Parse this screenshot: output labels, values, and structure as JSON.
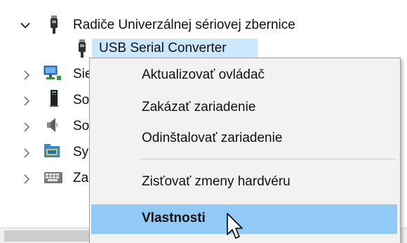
{
  "tree": {
    "usb_controllers": {
      "label": "Radiče Univerzálnej sériovej zbernice",
      "expanded": true,
      "icon": "usb-plug-icon"
    },
    "usb_serial": {
      "label": "USB Serial Converter",
      "selected": true,
      "icon": "usb-plug-icon"
    },
    "network": {
      "label": "Sie",
      "icon": "network-adapter-icon"
    },
    "software": {
      "label": "So",
      "icon": "tower-pc-icon"
    },
    "sound": {
      "label": "So",
      "icon": "speaker-icon"
    },
    "system": {
      "label": "Sy",
      "icon": "system-folder-icon"
    },
    "keyboards": {
      "label": "Za",
      "icon": "keyboard-icon"
    }
  },
  "context_menu": {
    "items": [
      {
        "label": "Aktualizovať ovládač"
      },
      {
        "label": "Zakázať zariadenie"
      },
      {
        "label": "Odinštalovať zariadenie"
      },
      {
        "label": "Zisťovať zmeny hardvéru"
      },
      {
        "label": "Vlastnosti",
        "default": true,
        "highlighted": true
      }
    ]
  },
  "colors": {
    "selection": "#cce8ff",
    "menu_highlight": "#91c9f7",
    "menu_background": "#f2f2f2"
  }
}
